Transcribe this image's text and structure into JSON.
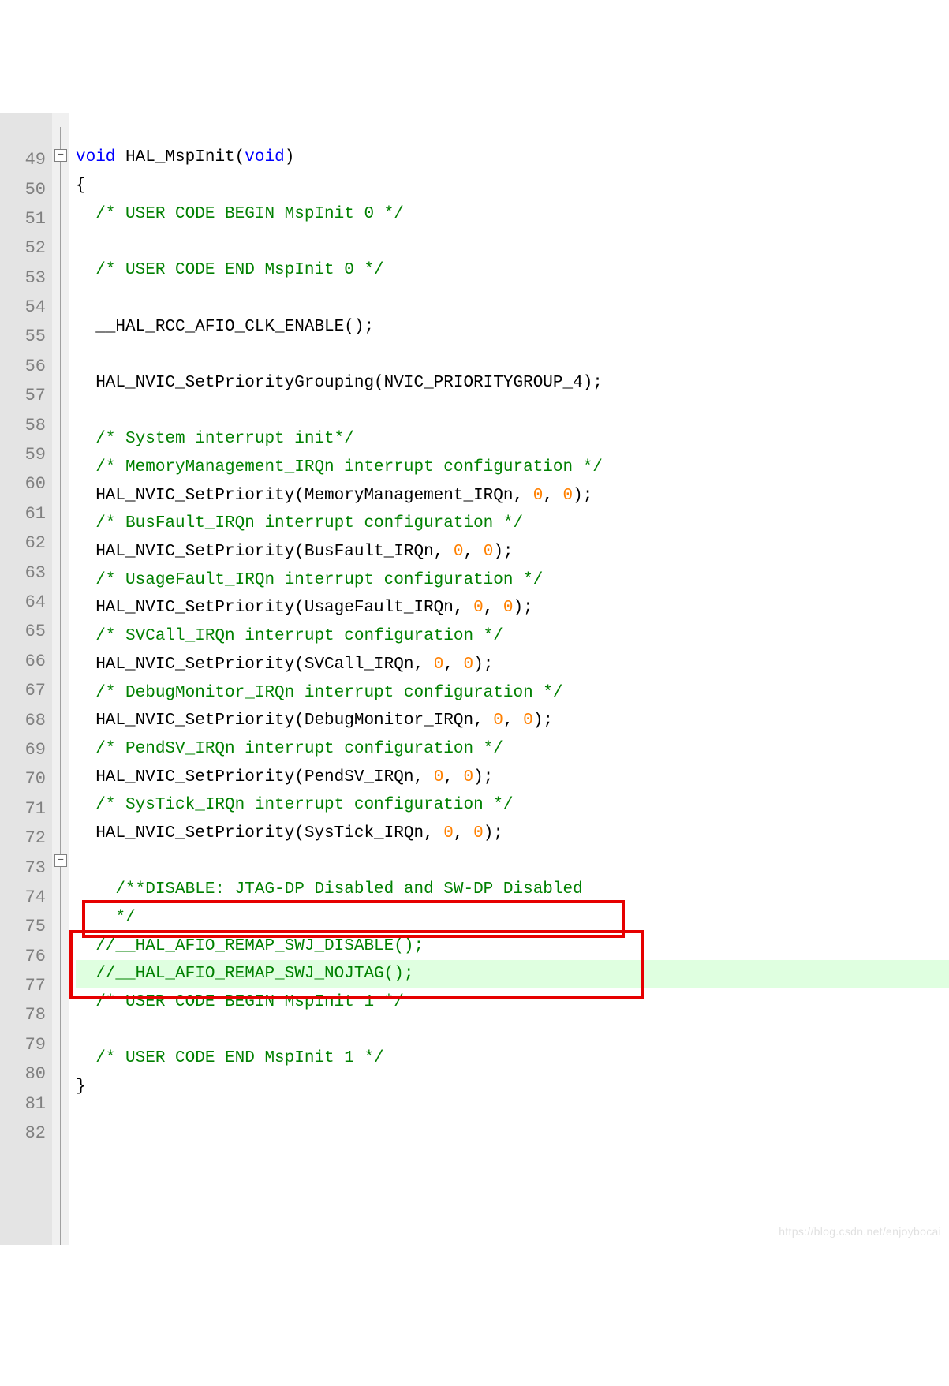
{
  "linenums": [
    "49",
    "50",
    "51",
    "52",
    "53",
    "54",
    "55",
    "56",
    "57",
    "58",
    "59",
    "60",
    "61",
    "62",
    "63",
    "64",
    "65",
    "66",
    "67",
    "68",
    "69",
    "70",
    "71",
    "72",
    "73",
    "74",
    "75",
    "76",
    "77",
    "78",
    "79",
    "80",
    "81",
    "82"
  ],
  "code": {
    "l49_void": "void",
    "l49_fn": " HAL_MspInit",
    "l49_rest": "(",
    "l49_void2": "void",
    "l49_close": ")",
    "l50": "{",
    "l51": "  /* USER CODE BEGIN MspInit 0 */",
    "l53": "  /* USER CODE END MspInit 0 */",
    "l55": "  __HAL_RCC_AFIO_CLK_ENABLE();",
    "l57": "  HAL_NVIC_SetPriorityGrouping(NVIC_PRIORITYGROUP_4);",
    "l59": "  /* System interrupt init*/",
    "l60": "  /* MemoryManagement_IRQn interrupt configuration */",
    "l61a": "  HAL_NVIC_SetPriority(MemoryManagement_IRQn, ",
    "l61n1": "0",
    "l61m": ", ",
    "l61n2": "0",
    "l61z": ");",
    "l62": "  /* BusFault_IRQn interrupt configuration */",
    "l63a": "  HAL_NVIC_SetPriority(BusFault_IRQn, ",
    "l63n1": "0",
    "l63m": ", ",
    "l63n2": "0",
    "l63z": ");",
    "l64": "  /* UsageFault_IRQn interrupt configuration */",
    "l65a": "  HAL_NVIC_SetPriority(UsageFault_IRQn, ",
    "l65n1": "0",
    "l65m": ", ",
    "l65n2": "0",
    "l65z": ");",
    "l66": "  /* SVCall_IRQn interrupt configuration */",
    "l67a": "  HAL_NVIC_SetPriority(SVCall_IRQn, ",
    "l67n1": "0",
    "l67m": ", ",
    "l67n2": "0",
    "l67z": ");",
    "l68": "  /* DebugMonitor_IRQn interrupt configuration */",
    "l69a": "  HAL_NVIC_SetPriority(DebugMonitor_IRQn, ",
    "l69n1": "0",
    "l69m": ", ",
    "l69n2": "0",
    "l69z": ");",
    "l70": "  /* PendSV_IRQn interrupt configuration */",
    "l71a": "  HAL_NVIC_SetPriority(PendSV_IRQn, ",
    "l71n1": "0",
    "l71m": ", ",
    "l71n2": "0",
    "l71z": ");",
    "l72": "  /* SysTick_IRQn interrupt configuration */",
    "l73a": "  HAL_NVIC_SetPriority(SysTick_IRQn, ",
    "l73n1": "0",
    "l73m": ", ",
    "l73n2": "0",
    "l73z": ");",
    "l75": "    /**DISABLE: JTAG-DP Disabled and SW-DP Disabled",
    "l76": "    */",
    "l77": "  //__HAL_AFIO_REMAP_SWJ_DISABLE();",
    "l78": "  //__HAL_AFIO_REMAP_SWJ_NOJTAG();",
    "l79": "  /* USER CODE BEGIN MspInit 1 */",
    "l81": "  /* USER CODE END MspInit 1 */",
    "l82": "}"
  },
  "fold": {
    "minus": "−"
  },
  "watermark": "https://blog.csdn.net/enjoybocai"
}
